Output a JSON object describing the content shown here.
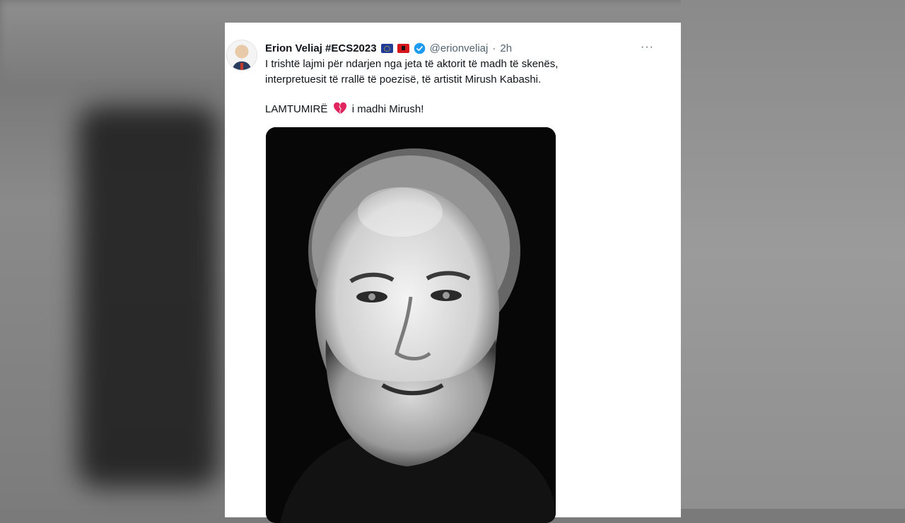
{
  "tweet": {
    "author_name": "Erion Veliaj #ECS2023",
    "handle": "@erionveliaj",
    "separator": "·",
    "time_ago": "2h",
    "more_label": "···",
    "text_line1": "I trishtë lajmi për ndarjen nga jeta të aktorit të madh të skenës,",
    "text_line2": "interpretuesit të rrallë të poezisë, të artistit Mirush Kabashi.",
    "farewell_prefix": "LAMTUMIRË",
    "farewell_suffix": "i madhi Mirush!",
    "colors": {
      "verified": "#1d9bf0",
      "heart": "#e0245e",
      "text": "#0f1419",
      "muted": "#536471"
    }
  },
  "icons": {
    "flag_eu": "eu-flag-icon",
    "flag_albania": "albania-flag-icon",
    "verified": "verified-badge-icon",
    "broken_heart": "broken-heart-icon",
    "more": "more-options-icon"
  }
}
